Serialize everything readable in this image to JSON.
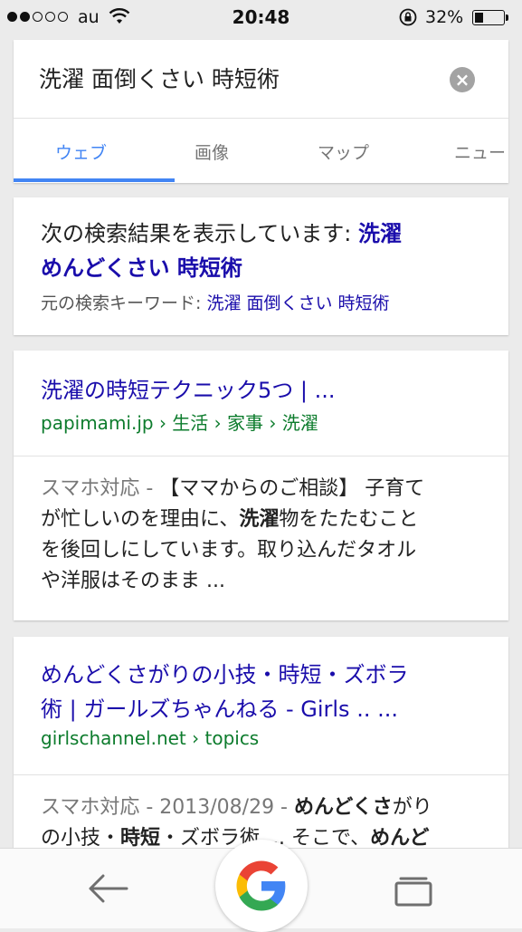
{
  "status_bar": {
    "carrier": "au",
    "time": "20:48",
    "battery_percent": "32%",
    "battery_level": 0.32
  },
  "search": {
    "query": "洗濯 面倒くさい 時短術",
    "clear_icon": "clear-icon"
  },
  "tabs": [
    {
      "label": "ウェブ",
      "active": true
    },
    {
      "label": "画像",
      "active": false
    },
    {
      "label": "マップ",
      "active": false
    },
    {
      "label": "ニュー",
      "active": false
    }
  ],
  "correction": {
    "prefix": "次の検索結果を表示しています: ",
    "corrected_part1": "洗濯",
    "corrected_part2": "めんどくさい 時短術",
    "original_label": "元の検索キーワード: ",
    "original_query": "洗濯 面倒くさい 時短術"
  },
  "results": [
    {
      "title": "洗濯の時短テクニック5つ | ...",
      "url": "papimami.jp › 生活 › 家事 › 洗濯",
      "snippet_label": "スマホ対応 - ",
      "snippet_line1": "【ママからのご相談】 子育て",
      "snippet_line2_a": "が忙しいのを理由に、",
      "snippet_line2_b": "洗濯",
      "snippet_line2_c": "物をたたむこと",
      "snippet_line3": "を後回しにしています。取り込んだタオル",
      "snippet_line4": "や洋服はそのまま ..."
    },
    {
      "title_line1": "めんどくさがりの小技・時短・ズボラ",
      "title_line2": "術 | ガールズちゃんねる - Girls .. ...",
      "url": "girlschannel.net › topics",
      "snippet_label": "スマホ対応 - 2013/08/29 - ",
      "snippet_line1_b": "めんどくさ",
      "snippet_line1_c": "がり",
      "snippet_line2_a": "の小技・",
      "snippet_line2_b": "時短",
      "snippet_line2_c": "・ズボラ術 ... そこで、",
      "snippet_line2_d": "めんど"
    }
  ],
  "bottom_bar": {
    "back_icon": "back-arrow-icon",
    "google_icon": "google-g-icon",
    "tabs_icon": "tabs-icon"
  }
}
